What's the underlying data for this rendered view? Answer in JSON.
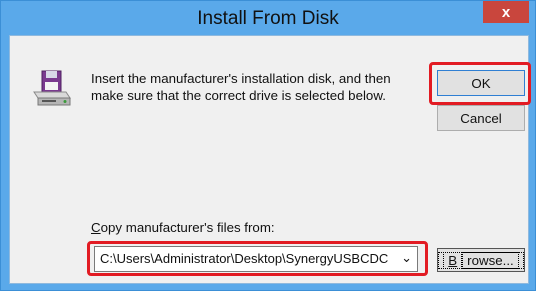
{
  "window": {
    "title": "Install From Disk",
    "close_glyph": "x"
  },
  "dialog": {
    "icon": "floppy-disk-drive-icon",
    "message": "Insert the manufacturer's installation disk, and then make sure that the correct drive is selected below.",
    "ok_label": "OK",
    "cancel_label": "Cancel",
    "copy_label_access_key": "C",
    "copy_label_rest": "opy manufacturer's files from:",
    "path_value": "C:\\Users\\Administrator\\Desktop\\SynergyUSBCDC",
    "dropdown_glyph": "⌄",
    "browse_access_key": "B",
    "browse_rest": "rowse..."
  },
  "colors": {
    "title_bar": "#5aa9ea",
    "close_button": "#c9463d",
    "highlight": "#e21b23",
    "dialog_body": "#f0f0f0"
  }
}
